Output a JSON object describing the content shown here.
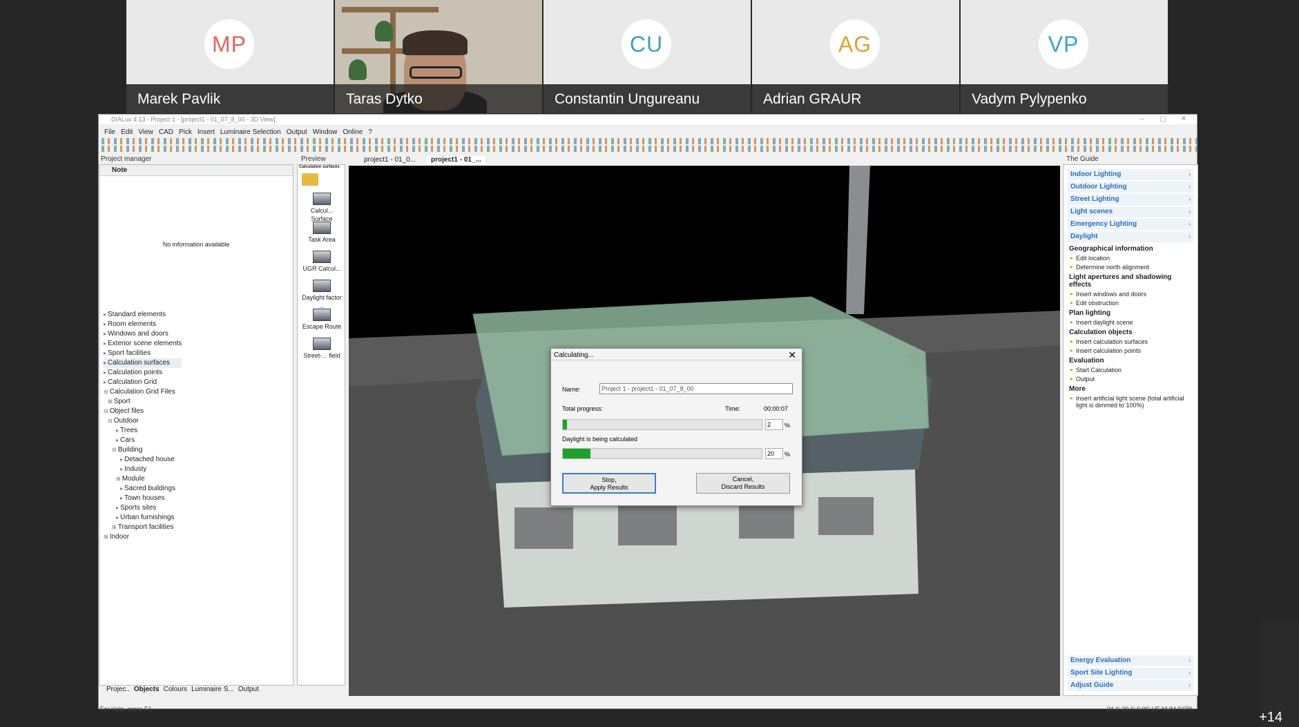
{
  "participants": [
    {
      "initials": "MP",
      "name": "Marek Pavlik",
      "color": "#e0675a"
    },
    {
      "initials": "",
      "name": "Taras Dytko",
      "color": ""
    },
    {
      "initials": "CU",
      "name": "Constantin Ungureanu",
      "color": "#3aa3b6"
    },
    {
      "initials": "AG",
      "name": "Adrian GRAUR",
      "color": "#e0a22a"
    },
    {
      "initials": "VP",
      "name": "Vadym Pylypenko",
      "color": "#3a9fd8"
    }
  ],
  "extra_count": "+14",
  "app": {
    "title": "DIALux 4.13 - Project 1 - [project1 - 01_07_8_00 - 3D View]",
    "menu": [
      "File",
      "Edit",
      "View",
      "CAD",
      "Pick",
      "Insert",
      "Luminaire Selection",
      "Output",
      "Window",
      "Online",
      "?"
    ],
    "project_manager_title": "Project manager",
    "note_header": "Note",
    "no_info": "No information available",
    "tree": [
      "Standard elements",
      "Room elements",
      "Windows and doors",
      "Exterior scene elements",
      "Sport facilities",
      "Calculation surfaces",
      "Calculation points",
      "Calculation Grid",
      "Calculation Grid Files",
      "Sport",
      "Object files",
      "Outdoor",
      "Trees",
      "Cars",
      "Building",
      "Detached house",
      "Industy",
      "Module",
      "Sacred buildings",
      "Town houses",
      "Sports sites",
      "Urban furnishings",
      "Transport facilities",
      "Indoor"
    ],
    "bottom_tabs": [
      "Projec..",
      "Objects",
      "Colours",
      "Luminaire S...",
      "Output"
    ],
    "preview_title": "Preview",
    "preview_sub": "Calculation surfaces",
    "preview_items": [
      "Calcul... Surface",
      "Task Area",
      "UGR Calcul...",
      "Daylight factor ...",
      "Escape Route",
      "Street-... field"
    ],
    "tabs": [
      "project1 - 01_0...",
      "project1 - 01_..."
    ],
    "guide_title": "The Guide",
    "guide_headers": [
      "Indoor Lighting",
      "Outdoor Lighting",
      "Street Lighting",
      "Light scenes",
      "Emergency Lighting",
      "Daylight"
    ],
    "guide_sections": [
      {
        "title": "Geographical information",
        "items": [
          "Edit location",
          "Determine north alignment"
        ]
      },
      {
        "title": "Light apertures and shadowing effects",
        "items": [
          "Insert windows and doors",
          "Edit obstruction"
        ]
      },
      {
        "title": "Plan lighting",
        "items": [
          "Insert daylight scene"
        ]
      },
      {
        "title": "Calculation objects",
        "items": [
          "Insert calculation surfaces",
          "Insert calculation points"
        ]
      },
      {
        "title": "Evaluation",
        "items": [
          "Start Calculation",
          "Output"
        ]
      },
      {
        "title": "More",
        "items": [
          "Insert artificial light scene (total artificial light is dimmed to 100%)"
        ]
      }
    ],
    "guide_footer": [
      "Energy Evaluation",
      "Sport Site Lighting",
      "Adjust Guide"
    ],
    "status_left": "For Help, press F1.",
    "status_right": "24.1'  20.1'  0.0C UF  NUM  SCRL"
  },
  "dialog": {
    "title": "Calculating...",
    "name_label": "Name:",
    "name_value": "Project 1 - project1 - 01_07_8_00",
    "total_label": "Total progress:",
    "time_label": "Time:",
    "time_value": "00:00:07",
    "total_pct": "2",
    "total_fraction": 0.02,
    "daylight_label": "Daylight is being calculated",
    "daylight_pct": "20",
    "daylight_fraction": 0.14,
    "pct_sign": "%",
    "stop_label": "Stop,\nApply Results",
    "cancel_label": "Cancel,\nDiscard Results"
  }
}
